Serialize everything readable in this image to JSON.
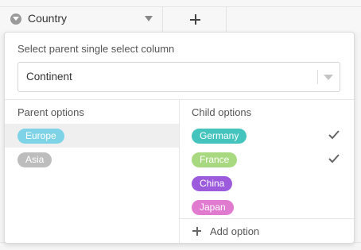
{
  "column": {
    "name": "Country",
    "type_icon": "single-select-icon",
    "dropdown_icon": "caret-down-icon",
    "add_column_icon": "plus-icon"
  },
  "popover": {
    "title": "Select parent single select column",
    "select": {
      "value": "Continent",
      "arrow_icon": "caret-down-icon"
    },
    "parent_label": "Parent options",
    "child_label": "Child options",
    "parent_options": [
      {
        "label": "Europe",
        "color": "#7ed3e6",
        "selected": true
      },
      {
        "label": "Asia",
        "color": "#bdbdbd",
        "selected": false
      }
    ],
    "child_options": [
      {
        "label": "Germany",
        "color": "#44c4bd",
        "checked": true
      },
      {
        "label": "France",
        "color": "#a8d880",
        "checked": true
      },
      {
        "label": "China",
        "color": "#9b5bdc",
        "checked": false
      },
      {
        "label": "Japan",
        "color": "#e07bd0",
        "checked": false
      }
    ],
    "add_option_label": "Add option",
    "check_icon": "check-icon"
  }
}
